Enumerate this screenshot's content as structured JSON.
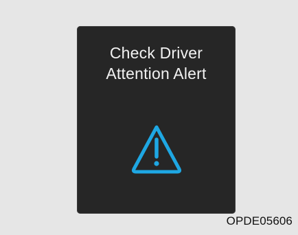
{
  "alert": {
    "line1": "Check Driver",
    "line2": "Attention Alert",
    "icon": "warning-triangle-icon",
    "icon_color": "#1ea7e3"
  },
  "figure_code": "OPDE05606"
}
